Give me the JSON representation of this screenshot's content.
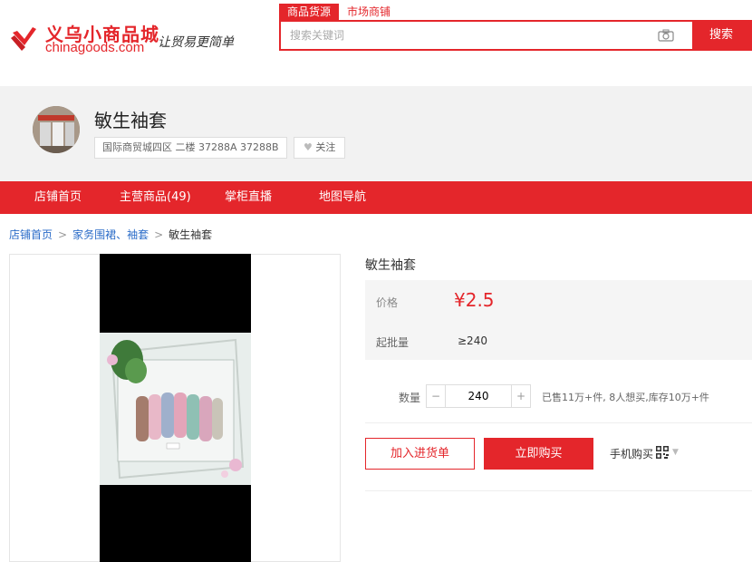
{
  "header": {
    "logo_cn": "义乌小商品城",
    "logo_en": "chinagoods.com",
    "slogan": "让贸易更简单",
    "search_tabs": [
      "商品货源",
      "市场商铺"
    ],
    "search_placeholder": "搜索关键词",
    "search_button": "搜索"
  },
  "shop": {
    "name": "敏生袖套",
    "address": "国际商贸城四区 二楼 37288A 37288B",
    "follow_label": "关注"
  },
  "nav": {
    "items": [
      "店铺首页",
      "主营商品(49)",
      "掌柜直播",
      "地图导航"
    ]
  },
  "breadcrumb": {
    "items": [
      "店铺首页",
      "家务围裙、袖套",
      "敏生袖套"
    ]
  },
  "product": {
    "title": "敏生袖套",
    "price_label": "价格",
    "price": "¥2.5",
    "moq_label": "起批量",
    "moq": "≥240",
    "qty_label": "数量",
    "qty_value": "240",
    "qty_minus": "−",
    "qty_plus": "+",
    "stock_info": "已售11万+件, 8人想买,库存10万+件",
    "add_cart": "加入进货单",
    "buy_now": "立即购买",
    "mobile_buy": "手机购买"
  },
  "colors": {
    "brand": "#e4262b",
    "link": "#2b6cc8"
  }
}
